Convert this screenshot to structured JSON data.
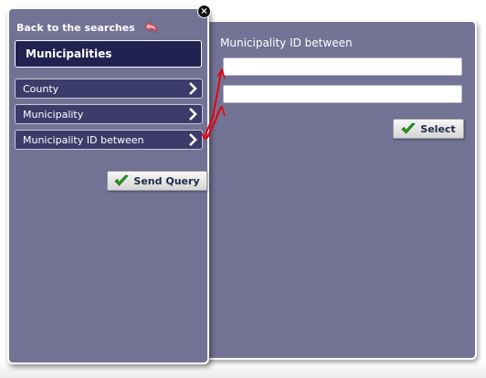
{
  "search_panel": {
    "back_label": "Back to the searches",
    "heading": "Municipalities",
    "items": [
      {
        "label": "County"
      },
      {
        "label": "Municipality"
      },
      {
        "label": "Municipality ID between"
      }
    ],
    "send_query_label": "Send Query",
    "close_label": "×"
  },
  "detail_panel": {
    "title": "Municipality ID between",
    "input_from": {
      "value": "",
      "placeholder": ""
    },
    "input_to": {
      "value": "",
      "placeholder": ""
    },
    "select_label": "Select"
  },
  "colors": {
    "panel_background": "#717294",
    "heading_background": "#21224f",
    "nav_item_background": "#3b3c69",
    "connector": "#e8000b",
    "check": "#2a9d1a"
  },
  "icons": {
    "back": "undo-arrow-icon",
    "nav_item": "chevron-right-icon",
    "button": "checkmark-icon",
    "close": "close-icon"
  }
}
